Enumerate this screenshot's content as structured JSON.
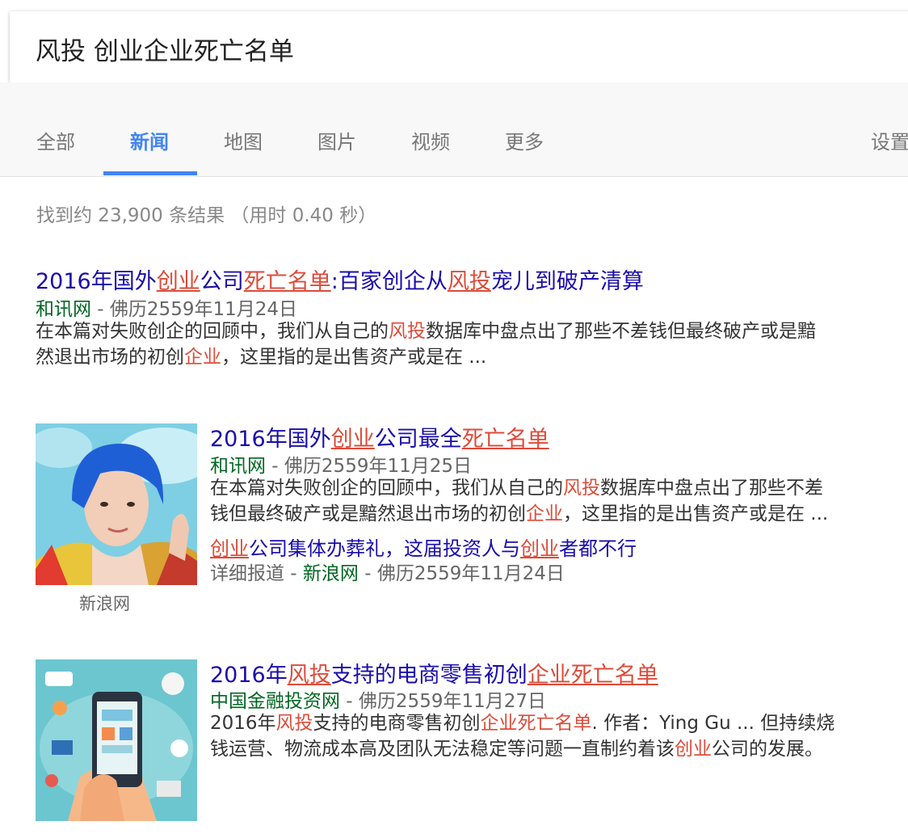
{
  "search": {
    "query": "风投 创业企业死亡名单"
  },
  "tabs": [
    "全部",
    "新闻",
    "地图",
    "图片",
    "视频",
    "更多"
  ],
  "settings_label": "设置",
  "stats": "找到约 23,900 条结果 （用时 0.40 秒）",
  "results": [
    {
      "title": [
        {
          "t": "2016年国外"
        },
        {
          "t": "创业",
          "h": true
        },
        {
          "t": "公司"
        },
        {
          "t": "死亡名单",
          "h": true
        },
        {
          "t": ":百家创企从"
        },
        {
          "t": "风投",
          "h": true
        },
        {
          "t": "宠儿到破产清算"
        }
      ],
      "source": "和讯网",
      "date": " - 佛历2559年11月24日",
      "snippet_line1": [
        {
          "t": "在本篇对失败创企的回顾中，我们从自己的"
        },
        {
          "t": "风投",
          "h": true
        },
        {
          "t": "数据库中盘点出了那些不差钱但最终破产或是黯"
        }
      ],
      "snippet_line2": [
        {
          "t": "然退出市场的初创"
        },
        {
          "t": "企业",
          "h": true
        },
        {
          "t": "，这里指的是出售资产或是在 ..."
        }
      ]
    },
    {
      "title": [
        {
          "t": "2016年国外"
        },
        {
          "t": "创业",
          "h": true
        },
        {
          "t": "公司最全"
        },
        {
          "t": "死亡名单",
          "h": true
        }
      ],
      "source": "和讯网",
      "date": " - 佛历2559年11月25日",
      "snippet_line1": [
        {
          "t": "在本篇对失败创企的回顾中，我们从自己的"
        },
        {
          "t": "风投",
          "h": true
        },
        {
          "t": "数据库中盘点出了那些不差"
        }
      ],
      "snippet_line2": [
        {
          "t": "钱但最终破产或是黯然退出市场的初创"
        },
        {
          "t": "企业",
          "h": true
        },
        {
          "t": "，这里指的是出售资产或是在 ..."
        }
      ],
      "related_title": [
        {
          "t": "创业",
          "h": true
        },
        {
          "t": "公司集体办葬礼，这届投资人与"
        },
        {
          "t": "创业",
          "h": true
        },
        {
          "t": "者都不行"
        }
      ],
      "related_prefix": "详细报道",
      "related_sep": " - ",
      "related_source": "新浪网",
      "related_date": " - 佛历2559年11月24日",
      "thumb_caption": "新浪网",
      "thumb_icon": "portrait-photo"
    },
    {
      "title": [
        {
          "t": "2016年"
        },
        {
          "t": "风投",
          "h": true
        },
        {
          "t": "支持的电商零售初创"
        },
        {
          "t": "企业死亡名单",
          "h": true
        }
      ],
      "source": "中国金融投资网",
      "date": " - 佛历2559年11月27日",
      "snippet_line1": [
        {
          "t": "2016年"
        },
        {
          "t": "风投",
          "h": true
        },
        {
          "t": "支持的电商零售初创"
        },
        {
          "t": "企业死亡名单",
          "h": true
        },
        {
          "t": ". 作者：Ying Gu ... 但持续烧"
        }
      ],
      "snippet_line2": [
        {
          "t": "钱运营、物流成本高及团队无法稳定等问题一直制约着该"
        },
        {
          "t": "创业",
          "h": true
        },
        {
          "t": "公司的发展。"
        }
      ],
      "thumb_icon": "ecommerce-illustration"
    }
  ]
}
